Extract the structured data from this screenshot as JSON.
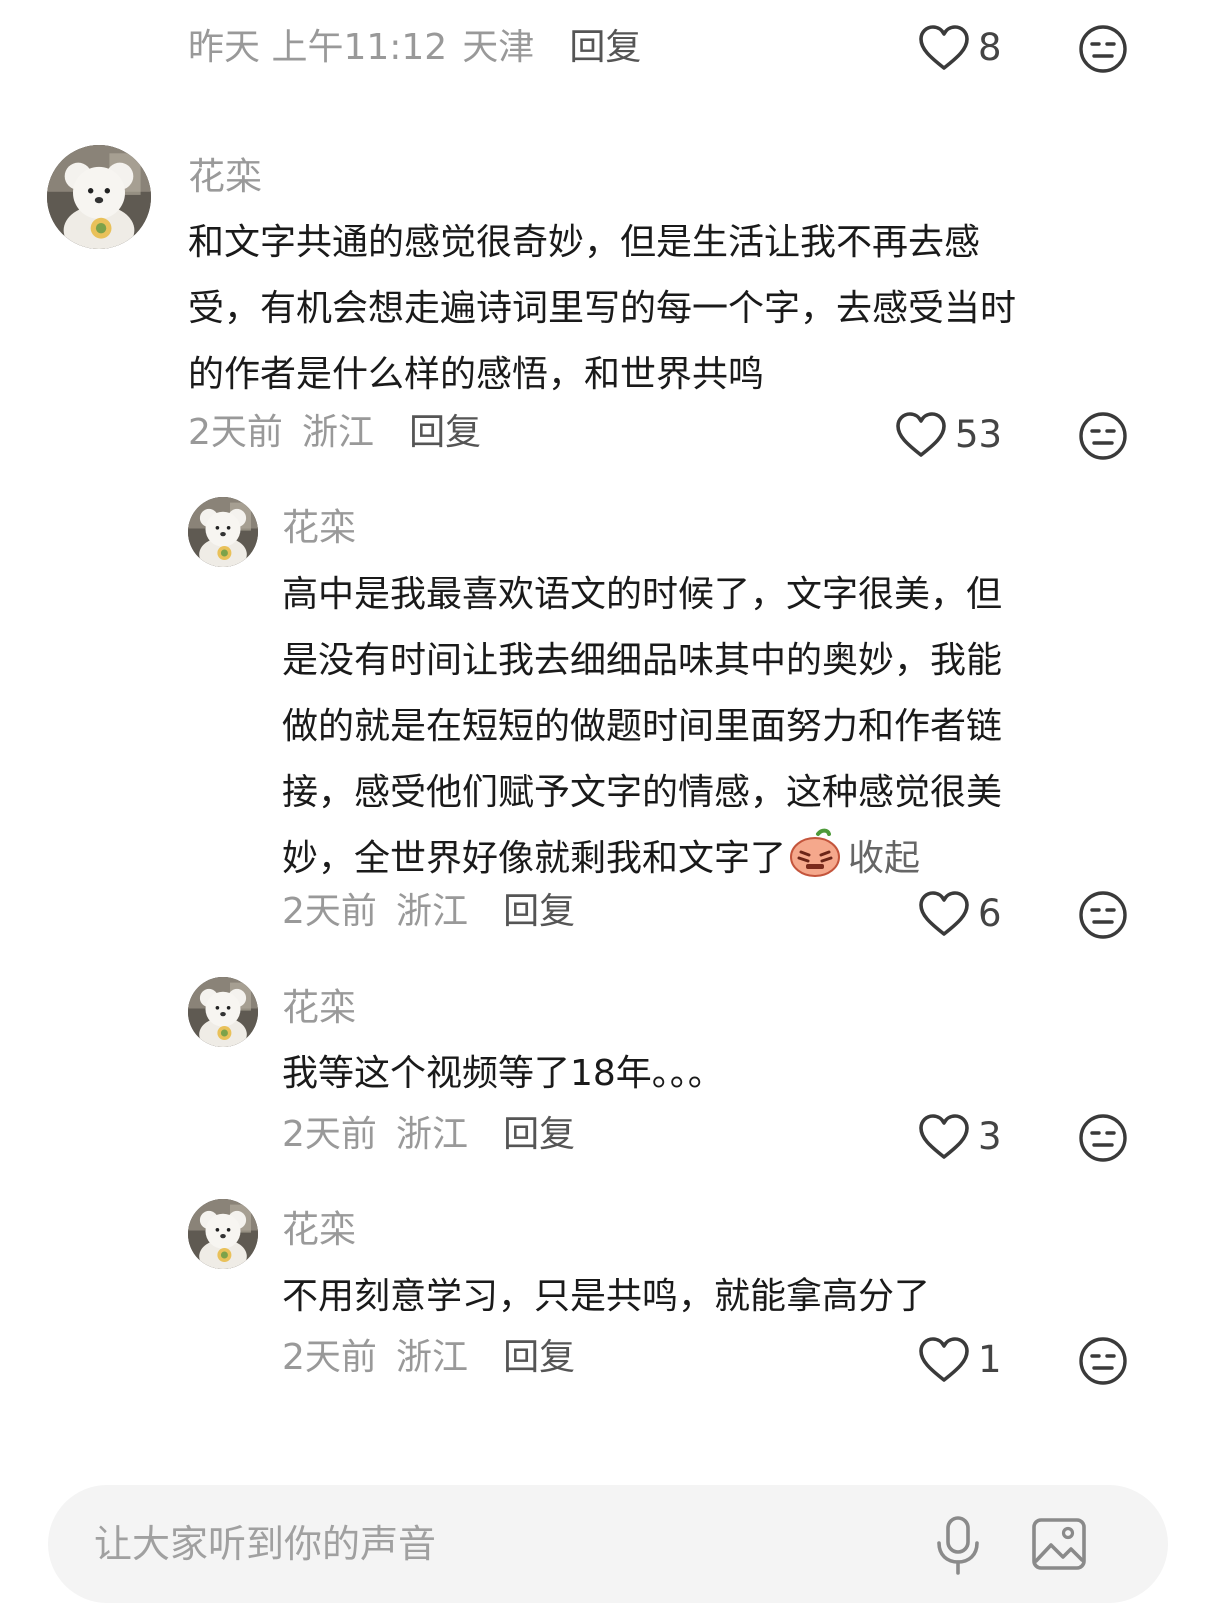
{
  "top_comment_footer": {
    "time": "昨天 上午11:12",
    "location": "天津",
    "reply_label": "回复",
    "likes": "8",
    "dislike_icon": "neutral-face-icon"
  },
  "comments": [
    {
      "username": "花栾",
      "lines": [
        "和文字共通的感觉很奇妙，但是生活让我不再去感",
        "受，有机会想走遍诗词里写的每一个字，去感受当时",
        "的作者是什么样的感悟，和世界共鸣"
      ],
      "time": "2天前",
      "location": "浙江",
      "reply_label": "回复",
      "likes": "53"
    }
  ],
  "replies": [
    {
      "username": "花栾",
      "lines": [
        "高中是我最喜欢语文的时候了，文字很美，但",
        "是没有时间让我去细细品味其中的奥妙，我能",
        "做的就是在短短的做题时间里面努力和作者链",
        "接，感受他们赋予文字的情感，这种感觉很美",
        "妙，全世界好像就剩我和文字了"
      ],
      "emoji": "crying-face-emoji",
      "collapse_label": "收起",
      "time": "2天前",
      "location": "浙江",
      "reply_label": "回复",
      "likes": "6"
    },
    {
      "username": "花栾",
      "lines": [
        "我等这个视频等了18年。。。"
      ],
      "time": "2天前",
      "location": "浙江",
      "reply_label": "回复",
      "likes": "3"
    },
    {
      "username": "花栾",
      "lines": [
        "不用刻意学习，只是共鸣，就能拿高分了"
      ],
      "time": "2天前",
      "location": "浙江",
      "reply_label": "回复",
      "likes": "1"
    }
  ],
  "input_bar": {
    "placeholder": "让大家听到你的声音",
    "mic_icon": "microphone-icon",
    "image_icon": "image-icon"
  }
}
